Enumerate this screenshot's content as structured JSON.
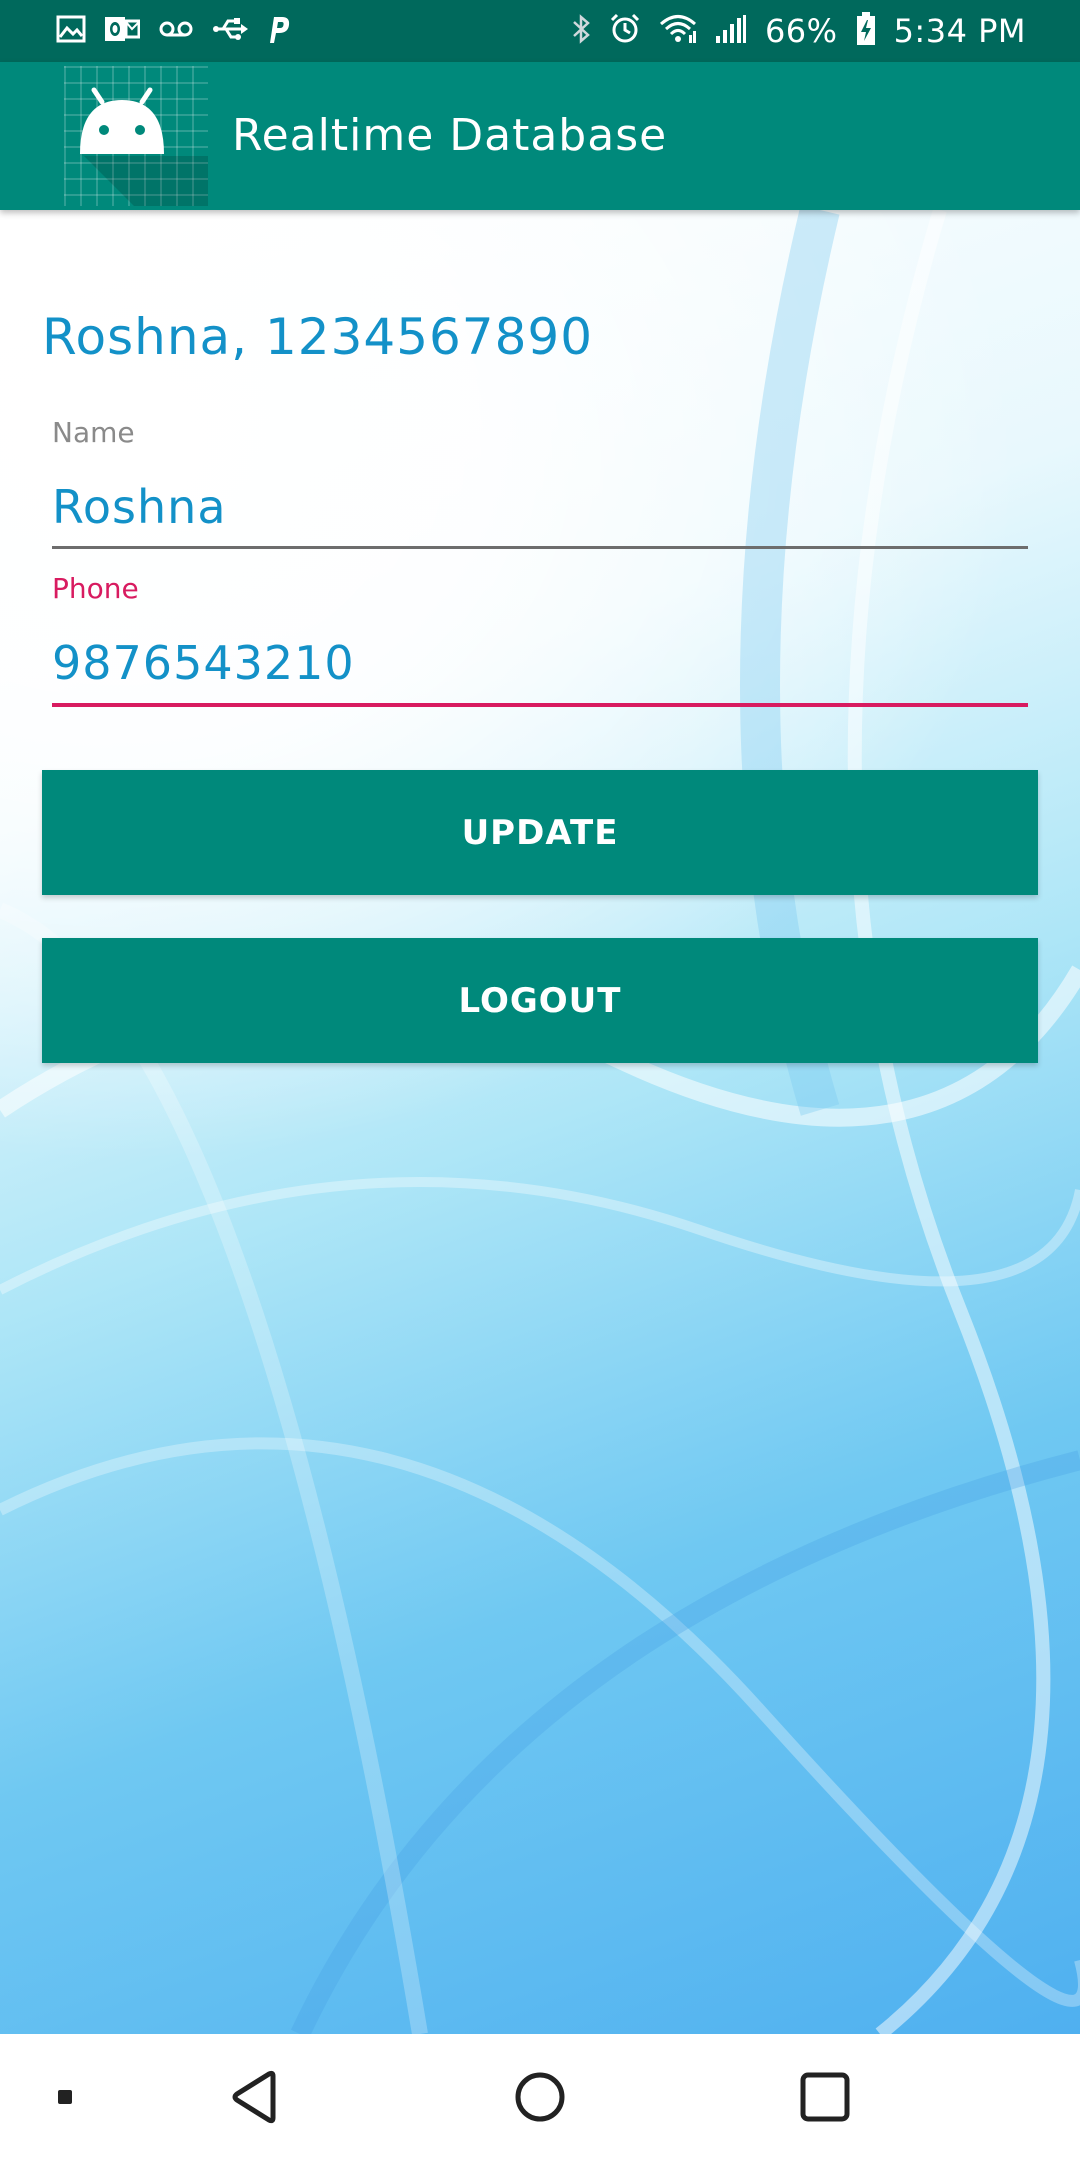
{
  "status_bar": {
    "battery_text": "66%",
    "time": "5:34 PM",
    "left_icons": [
      "image-icon",
      "outlook-icon",
      "voicemail-icon",
      "usb-icon",
      "p-app-icon"
    ],
    "right_icons": [
      "bluetooth-icon",
      "alarm-icon",
      "wifi-icon",
      "signal-icon",
      "battery-charging-icon"
    ]
  },
  "app_bar": {
    "title": "Realtime Database",
    "icon": "android-icon",
    "color": "#00897b"
  },
  "main": {
    "greeting": "Roshna, 1234567890",
    "name_field": {
      "label": "Name",
      "value": "Roshna"
    },
    "phone_field": {
      "label": "Phone",
      "value": "9876543210"
    },
    "update_button": "UPDATE",
    "logout_button": "LOGOUT"
  },
  "colors": {
    "primary": "#00897b",
    "primary_dark": "#00695c",
    "accent": "#d81b60",
    "text_blue": "#1391c8"
  },
  "nav_bar": {
    "icons": [
      "recent-dot-icon",
      "back-icon",
      "home-icon",
      "overview-icon"
    ]
  }
}
